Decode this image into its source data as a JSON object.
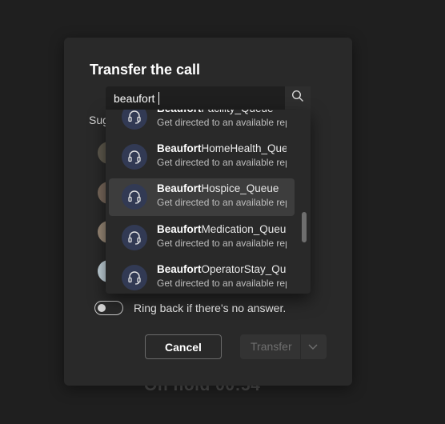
{
  "background": {
    "status_text": "On hold  00:54"
  },
  "dialog": {
    "title": "Transfer the call",
    "search": {
      "value": "beaufort",
      "placeholder": ""
    },
    "suggestions_label": "Sug",
    "results": [
      {
        "highlight": "Beaufort",
        "rest": "Facility_Queue",
        "description": "Get directed to an available rep",
        "icon": "headset-icon"
      },
      {
        "highlight": "Beaufort",
        "rest": "HomeHealth_Queue",
        "description": "Get directed to an available rep",
        "icon": "headset-icon"
      },
      {
        "highlight": "Beaufort",
        "rest": "Hospice_Queue",
        "description": "Get directed to an available rep",
        "icon": "headset-icon"
      },
      {
        "highlight": "Beaufort",
        "rest": "Medication_Queue",
        "description": "Get directed to an available rep",
        "icon": "headset-icon"
      },
      {
        "highlight": "Beaufort",
        "rest": "OperatorStay_Queue",
        "description": "Get directed to an available rep",
        "icon": "headset-icon"
      }
    ],
    "selected_index": 2,
    "ring_back": {
      "label": "Ring back if there's no answer.",
      "enabled": false
    },
    "buttons": {
      "cancel": "Cancel",
      "transfer": "Transfer"
    }
  },
  "colors": {
    "accent": "#7f85f5",
    "dialog_bg": "#292929",
    "page_bg": "#1f1f1f"
  }
}
